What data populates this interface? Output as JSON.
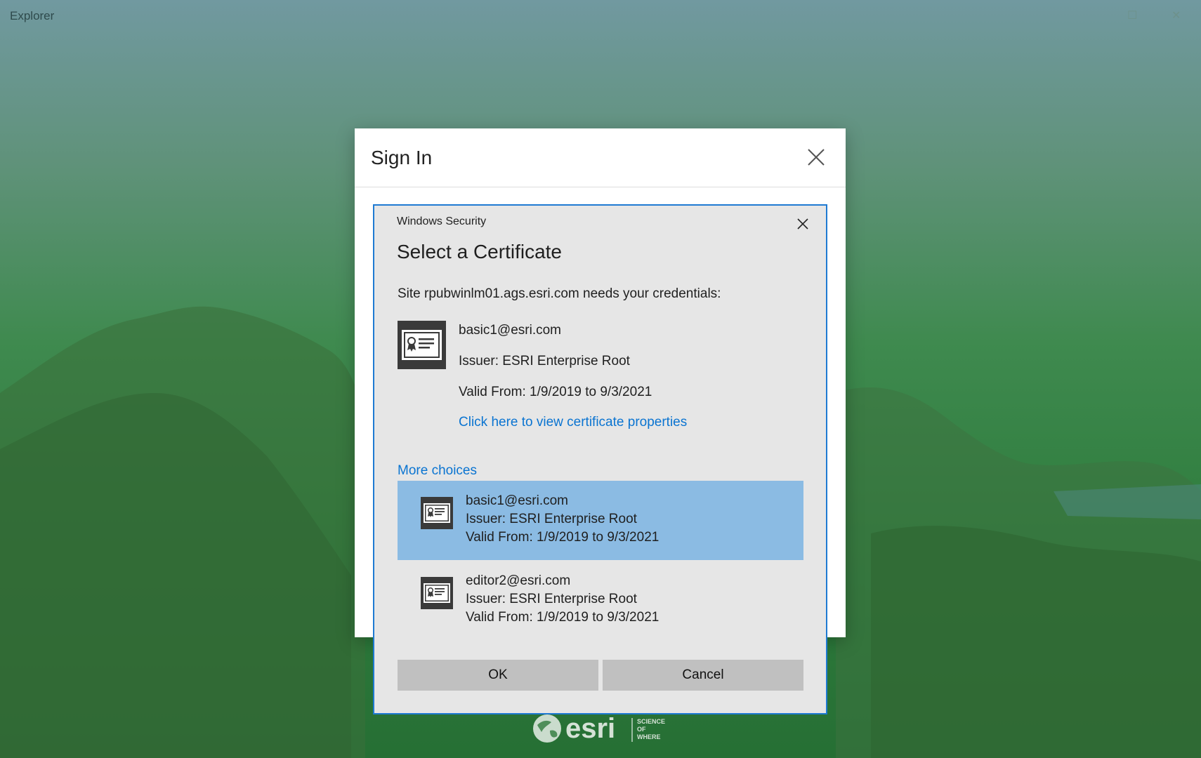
{
  "app": {
    "title": "Explorer"
  },
  "signin": {
    "title": "Sign In"
  },
  "winsec": {
    "caption": "Windows Security",
    "title": "Select a Certificate",
    "prompt": "Site rpubwinlm01.ags.esri.com needs your credentials:",
    "selected": {
      "email": "basic1@esri.com",
      "issuer": "Issuer: ESRI Enterprise Root",
      "valid": "Valid From: 1/9/2019 to 9/3/2021",
      "link": "Click here to view certificate properties"
    },
    "more_choices": "More choices",
    "choices": [
      {
        "email": "basic1@esri.com",
        "issuer": "Issuer: ESRI Enterprise Root",
        "valid": "Valid From: 1/9/2019 to 9/3/2021"
      },
      {
        "email": "editor2@esri.com",
        "issuer": "Issuer: ESRI Enterprise Root",
        "valid": "Valid From: 1/9/2019 to 9/3/2021"
      }
    ],
    "ok_label": "OK",
    "cancel_label": "Cancel"
  },
  "brand": {
    "name": "esri",
    "tagline": [
      "SCIENCE",
      "OF",
      "WHERE"
    ]
  },
  "colors": {
    "accent": "#0a74d1",
    "selection": "#8bbbe3",
    "border": "#1e7ad2"
  }
}
